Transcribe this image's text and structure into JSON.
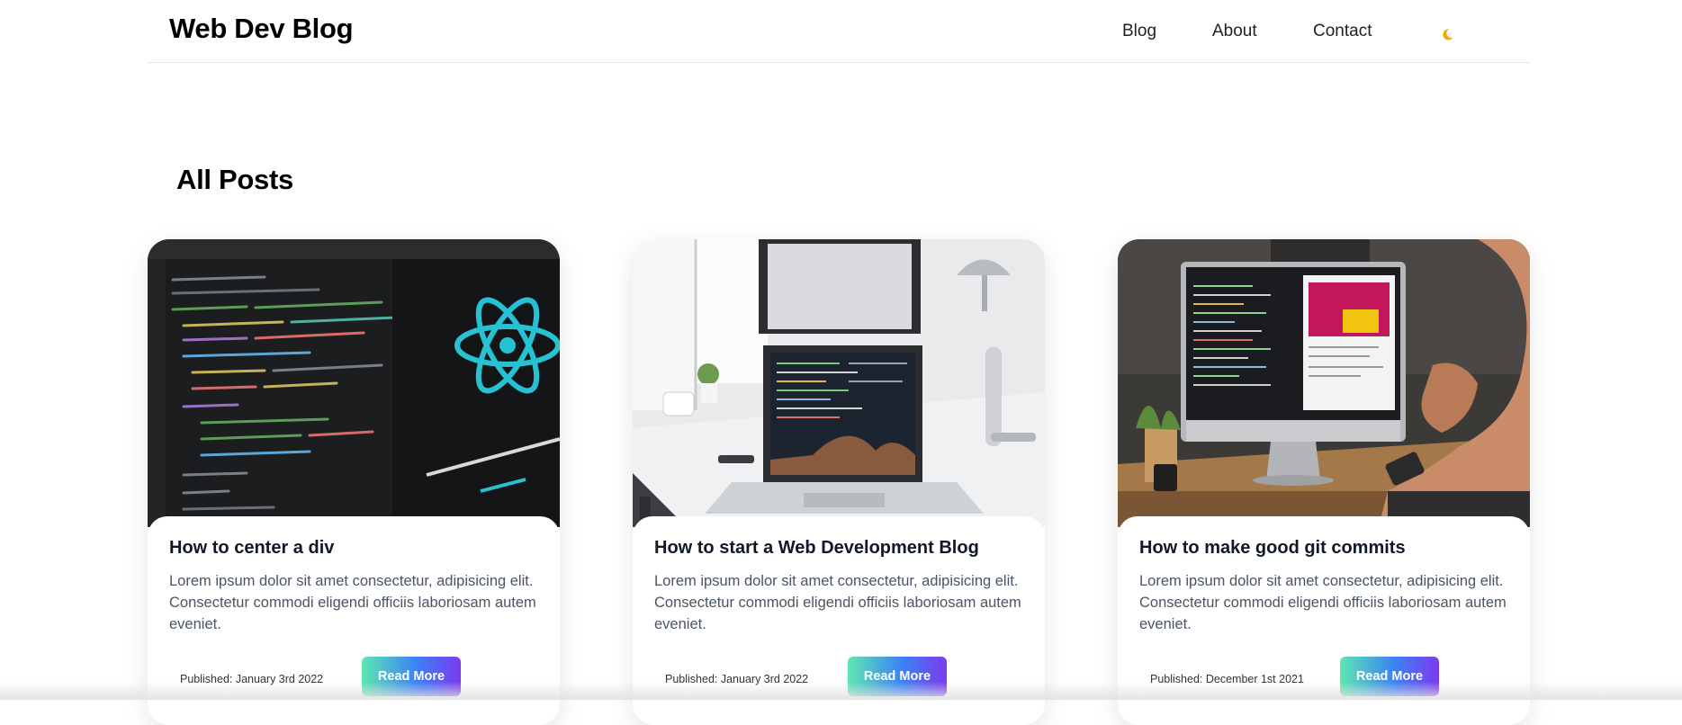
{
  "header": {
    "brand": "Web Dev Blog",
    "nav": {
      "blog": "Blog",
      "about": "About",
      "contact": "Contact"
    },
    "theme_icon": "moon-icon",
    "theme_icon_color": "#f2a900"
  },
  "main": {
    "title": "All Posts",
    "posts": [
      {
        "title": "How to center a div",
        "excerpt": "Lorem ipsum dolor sit amet consectetur, adipisicing elit. Consectetur commodi eligendi officiis laboriosam autem eveniet.",
        "date": "Published: January 3rd 2022",
        "button_label": "Read More",
        "image": "react-code-editor-image"
      },
      {
        "title": "How to start a Web Development Blog",
        "excerpt": "Lorem ipsum dolor sit amet consectetur, adipisicing elit. Consectetur commodi eligendi officiis laboriosam autem eveniet.",
        "date": "Published: January 3rd 2022",
        "button_label": "Read More",
        "image": "laptop-desk-image"
      },
      {
        "title": "How to make good git commits",
        "excerpt": "Lorem ipsum dolor sit amet consectetur, adipisicing elit. Consectetur commodi eligendi officiis laboriosam autem eveniet.",
        "date": "Published: December 1st 2021",
        "button_label": "Read More",
        "image": "imac-developer-image"
      }
    ]
  },
  "colors": {
    "button_gradient": [
      "#5ee7b0",
      "#3b82f6",
      "#7c3aed"
    ],
    "text_muted": "#4b5563",
    "divider": "#e5e5e5"
  }
}
